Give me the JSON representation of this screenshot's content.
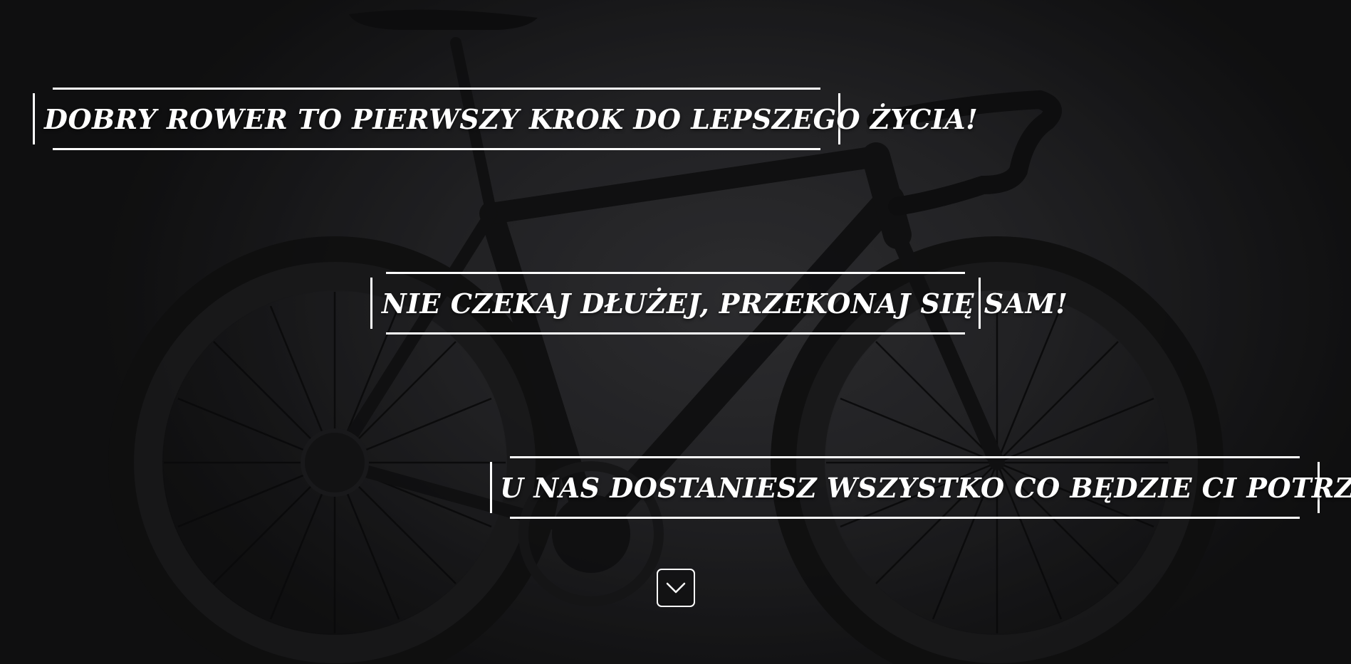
{
  "hero": {
    "headline_1": "DOBRY ROWER TO PIERWSZY KROK DO LEPSZEGO ŻYCIA!",
    "headline_2": "NIE CZEKAJ DŁUŻEJ, PRZEKONAJ SIĘ SAM!",
    "headline_3": "U NAS DOSTANIESZ WSZYSTKO CO BĘDZIE CI POTRZEBNE!",
    "text_color": "#ffffff",
    "background_color": "#2c2c2f"
  },
  "scroll_button": {
    "icon": "chevron-down-icon"
  }
}
